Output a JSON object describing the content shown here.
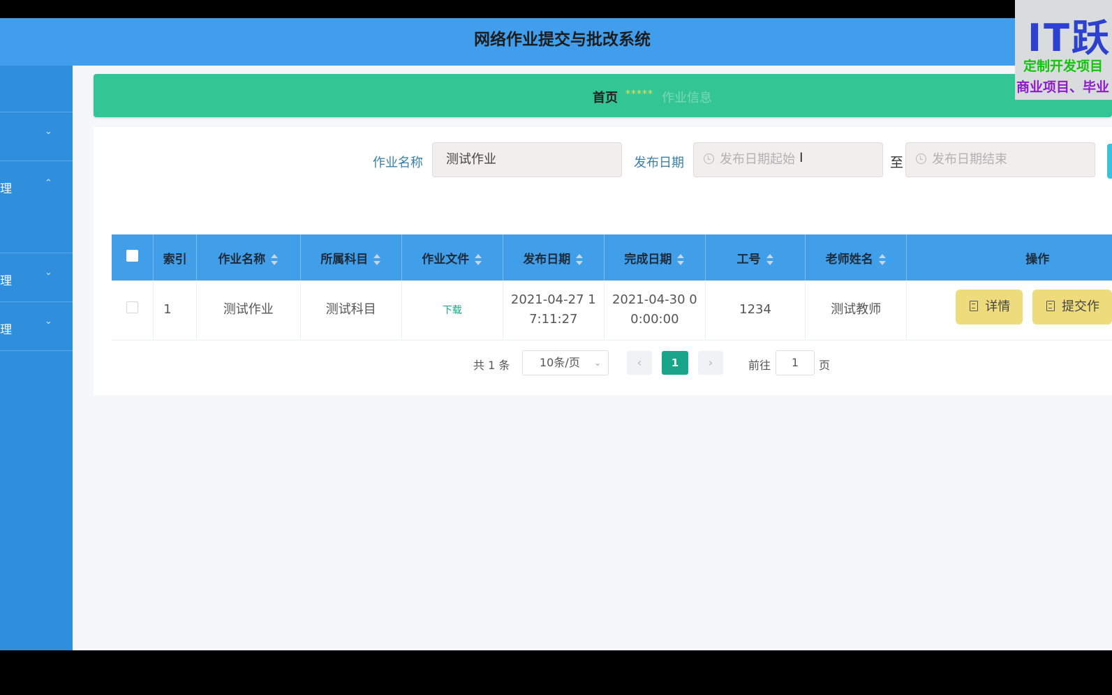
{
  "header": {
    "title": "网络作业提交与批改系统"
  },
  "sidebar": {
    "items": [
      {
        "label": "",
        "chevron": ""
      },
      {
        "label": "",
        "chevron": "⌄"
      },
      {
        "label": "理",
        "chevron": "⌃"
      },
      {
        "label": "理",
        "chevron": "⌄"
      },
      {
        "label": "理",
        "chevron": "⌄"
      }
    ]
  },
  "breadcrumb": {
    "home": "首页",
    "separator": "*****",
    "current": "作业信息"
  },
  "search": {
    "name_label": "作业名称",
    "name_value": "测试作业",
    "date_label": "发布日期",
    "start_placeholder": "发布日期起始",
    "to_label": "至",
    "end_placeholder": "发布日期结束"
  },
  "table": {
    "headers": [
      "索引",
      "作业名称",
      "所属科目",
      "作业文件",
      "发布日期",
      "完成日期",
      "工号",
      "老师姓名",
      "操作"
    ],
    "rows": [
      {
        "index": "1",
        "name": "测试作业",
        "subject": "测试科目",
        "file": "下载",
        "publish_date_l1": "2021-04-27 1",
        "publish_date_l2": "7:11:27",
        "finish_date_l1": "2021-04-30 0",
        "finish_date_l2": "0:00:00",
        "staff_no": "1234",
        "teacher": "测试教师",
        "actions": [
          "详情",
          "提交作"
        ]
      }
    ]
  },
  "pagination": {
    "total": "共 1 条",
    "page_size": "10条/页",
    "current_page": "1",
    "goto_label": "前往",
    "goto_value": "1",
    "page_suffix": "页"
  },
  "watermark": {
    "big": "IT跃",
    "line2": "定制开发项目",
    "line3": "商业项目、毕业"
  },
  "colors": {
    "header": "#409eec",
    "sidebar": "#2f8fdc",
    "breadcrumb": "#33c694",
    "table_header": "#419ee9",
    "accent": "#19a58a",
    "action_button": "#eedc7c"
  }
}
